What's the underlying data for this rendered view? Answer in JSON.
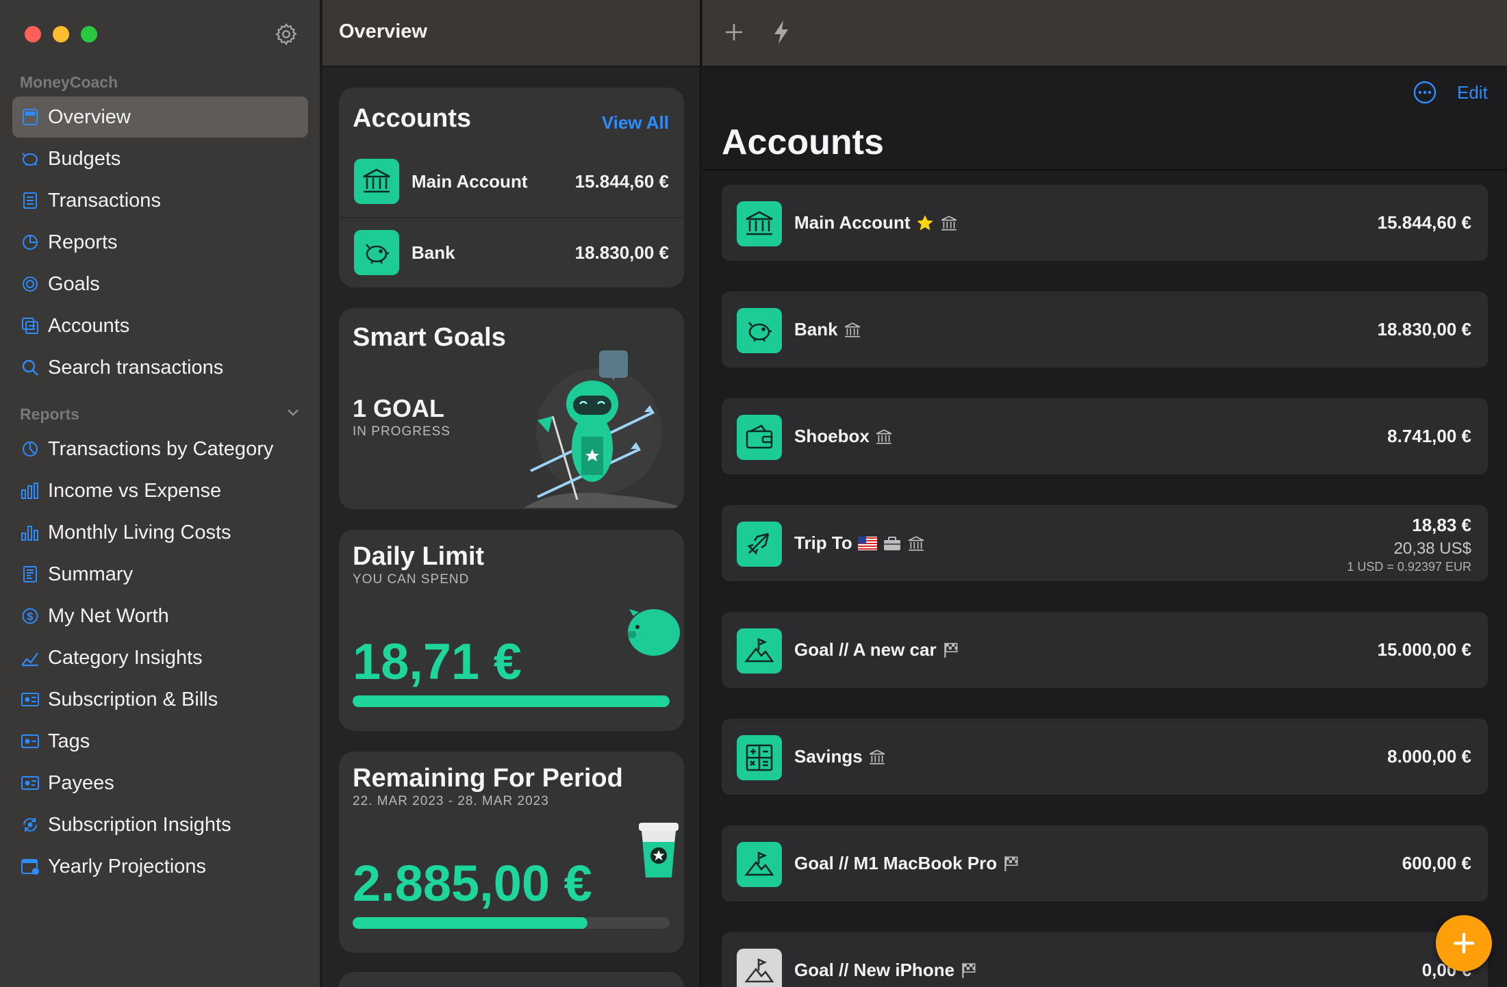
{
  "colors": {
    "accent": "#1ccb95",
    "link": "#2d8cff",
    "fab": "#ff9f0a",
    "close": "#fe5f57",
    "minimize": "#febc2e",
    "zoom": "#28c840"
  },
  "sidebar": {
    "app_name": "MoneyCoach",
    "items": [
      {
        "label": "Overview",
        "icon": "overview-icon",
        "active": true
      },
      {
        "label": "Budgets",
        "icon": "budgets-icon"
      },
      {
        "label": "Transactions",
        "icon": "transactions-icon"
      },
      {
        "label": "Reports",
        "icon": "reports-icon"
      },
      {
        "label": "Goals",
        "icon": "goals-icon"
      },
      {
        "label": "Accounts",
        "icon": "accounts-icon"
      },
      {
        "label": "Search transactions",
        "icon": "search-icon"
      }
    ],
    "reports_section": "Reports",
    "reports": [
      {
        "label": "Transactions by Category",
        "icon": "pie-chart-icon"
      },
      {
        "label": "Income vs Expense",
        "icon": "bar-chart-icon"
      },
      {
        "label": "Monthly Living Costs",
        "icon": "bar-chart-icon"
      },
      {
        "label": "Summary",
        "icon": "summary-icon"
      },
      {
        "label": "My Net Worth",
        "icon": "dollar-icon"
      },
      {
        "label": "Category Insights",
        "icon": "line-chart-icon"
      },
      {
        "label": "Subscription & Bills",
        "icon": "bills-icon"
      },
      {
        "label": "Tags",
        "icon": "tags-icon"
      },
      {
        "label": "Payees",
        "icon": "payees-icon"
      },
      {
        "label": "Subscription Insights",
        "icon": "subscription-insights-icon"
      },
      {
        "label": "Yearly Projections",
        "icon": "calendar-icon"
      }
    ]
  },
  "middle": {
    "title": "Overview",
    "accounts_card": {
      "title": "Accounts",
      "view_all": "View All",
      "rows": [
        {
          "name": "Main Account",
          "value": "15.844,60 €",
          "icon": "bank-icon"
        },
        {
          "name": "Bank",
          "value": "18.830,00 €",
          "icon": "piggy-bank-icon"
        }
      ]
    },
    "smart_goals": {
      "title": "Smart Goals",
      "count": "1 GOAL",
      "status": "IN PROGRESS"
    },
    "daily_limit": {
      "title": "Daily Limit",
      "subtitle": "YOU CAN SPEND",
      "amount": "18,71 €",
      "progress": 1.0
    },
    "remaining": {
      "title": "Remaining For Period",
      "range": "22. MAR 2023 - 28. MAR 2023",
      "amount": "2.885,00 €",
      "progress": 0.74
    }
  },
  "right": {
    "title": "Accounts",
    "edit": "Edit",
    "accounts": [
      {
        "name": "Main Account",
        "value": "15.844,60 €",
        "icon": "bank-icon",
        "badges": [
          "star-icon",
          "bank-badge-icon"
        ]
      },
      {
        "name": "Bank",
        "value": "18.830,00 €",
        "icon": "piggy-bank-icon",
        "badges": [
          "bank-badge-icon"
        ]
      },
      {
        "name": "Shoebox",
        "value": "8.741,00 €",
        "icon": "wallet-icon",
        "badges": [
          "bank-badge-icon"
        ]
      },
      {
        "name": "Trip To",
        "value": "18,83 €",
        "sub_value": "20,38 US$",
        "rate": "1 USD = 0.92397 EUR",
        "icon": "airplane-icon",
        "badges": [
          "us-flag-icon",
          "briefcase-icon",
          "bank-badge-icon"
        ]
      },
      {
        "name": "Goal // A new car",
        "value": "15.000,00 €",
        "icon": "mountain-flag-icon",
        "badges": [
          "checkered-flag-icon"
        ]
      },
      {
        "name": "Savings",
        "value": "8.000,00 €",
        "icon": "calculator-icon",
        "badges": [
          "bank-badge-icon"
        ]
      },
      {
        "name": "Goal // M1 MacBook Pro",
        "value": "600,00 €",
        "icon": "mountain-flag-icon",
        "badges": [
          "checkered-flag-icon"
        ]
      },
      {
        "name": "Goal // New iPhone",
        "value": "0,00 €",
        "icon": "mountain-flag-icon",
        "badges": [
          "checkered-flag-icon"
        ]
      }
    ]
  }
}
